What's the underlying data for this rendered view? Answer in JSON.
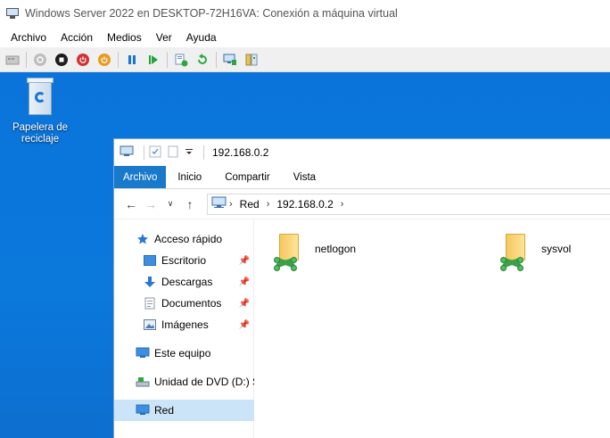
{
  "window": {
    "title": "Windows Server 2022 en DESKTOP-72H16VA: Conexión a máquina virtual"
  },
  "menu": [
    "Archivo",
    "Acción",
    "Medios",
    "Ver",
    "Ayuda"
  ],
  "toolbar_icons": [
    "ctrl-alt-del-icon",
    "start-icon",
    "turn-off-icon",
    "shutdown-icon",
    "save-icon",
    "pause-icon",
    "resume-icon",
    "checkpoint-icon",
    "revert-icon",
    "enhanced-session-icon",
    "basic-session-icon"
  ],
  "desktop": {
    "recycle_bin_label": "Papelera de reciclaje"
  },
  "explorer": {
    "title": "192.168.0.2",
    "tabs": [
      {
        "label": "Archivo",
        "active": true
      },
      {
        "label": "Inicio",
        "active": false
      },
      {
        "label": "Compartir",
        "active": false
      },
      {
        "label": "Vista",
        "active": false
      }
    ],
    "address": {
      "crumbs": [
        "Red",
        "192.168.0.2"
      ]
    },
    "nav": {
      "quick_access": "Acceso rápido",
      "items": [
        {
          "label": "Escritorio",
          "pinned": true
        },
        {
          "label": "Descargas",
          "pinned": true
        },
        {
          "label": "Documentos",
          "pinned": true
        },
        {
          "label": "Imágenes",
          "pinned": true
        }
      ],
      "this_pc": "Este equipo",
      "dvd": "Unidad de DVD (D:) S",
      "network": "Red"
    },
    "shares": [
      "netlogon",
      "sysvol"
    ]
  },
  "colors": {
    "desktop_blue": "#0a74da",
    "ribbon_file_tab": "#1979ca",
    "selected_nav": "#cce4f7"
  }
}
